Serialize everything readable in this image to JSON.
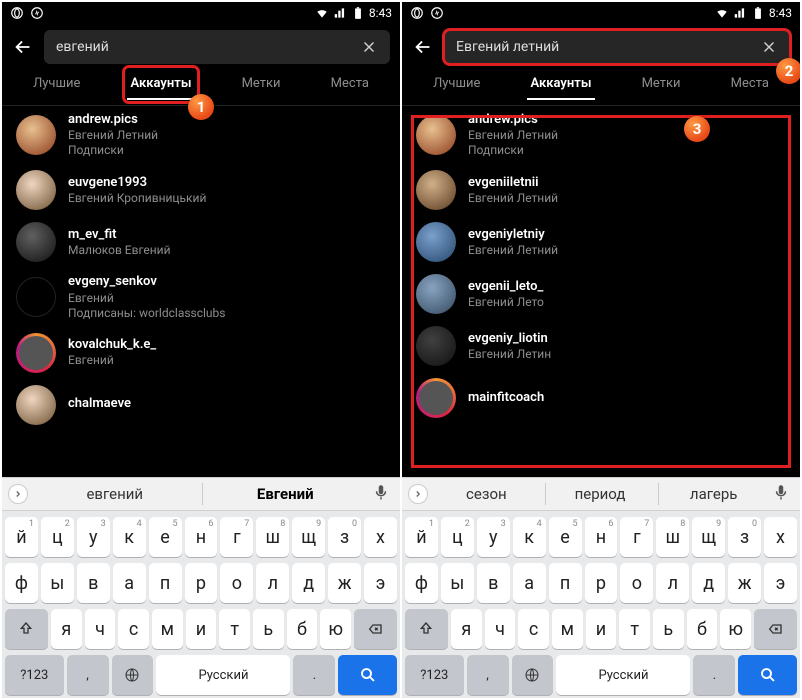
{
  "status": {
    "time": "8:43",
    "icons": [
      "opera-icon",
      "shazam-icon"
    ],
    "right_icons": [
      "wifi-icon",
      "signal-icon",
      "battery-icon"
    ]
  },
  "left": {
    "search": "евгений",
    "tabs": [
      "Лучшие",
      "Аккаунты",
      "Метки",
      "Места"
    ],
    "active_tab": 1,
    "results": [
      {
        "user": "andrew.pics",
        "full": "Евгений Летний",
        "sub": "Подписки",
        "av": "av-a"
      },
      {
        "user": "euvgene1993",
        "full": "Евгений Кропивницький",
        "av": "av-b"
      },
      {
        "user": "m_ev_fit",
        "full": "Малюков Евгений",
        "av": "av-c"
      },
      {
        "user": "evgeny_senkov",
        "full": "Евгений",
        "sub": "Подписаны: worldclassclubs",
        "av": "av-d"
      },
      {
        "user": "kovalchuk_k.e_",
        "full": "Евгений",
        "av": "ring"
      },
      {
        "user": "chalmaeve",
        "full": "",
        "av": "av-b"
      }
    ],
    "suggestions": [
      "евгений",
      "Евгений"
    ],
    "suggest_selected": 1
  },
  "right": {
    "search": "Евгений летний",
    "tabs": [
      "Лучшие",
      "Аккаунты",
      "Метки",
      "Места"
    ],
    "active_tab": 1,
    "results": [
      {
        "user": "andrew.pics",
        "full": "Евгений Летний",
        "sub": "Подписки",
        "av": "av-a"
      },
      {
        "user": "evgeniiletnii",
        "full": "Евгений Летний",
        "av": "av-f"
      },
      {
        "user": "evgeniyletniy",
        "full": "Евгений Летний",
        "av": "av-e"
      },
      {
        "user": "evgenii_leto_",
        "full": "Евгений Лето",
        "av": "av-g"
      },
      {
        "user": "evgeniy_liotin",
        "full": "Евгений Летин",
        "av": "av-h"
      },
      {
        "user": "mainfitcoach",
        "full": "",
        "av": "ring"
      }
    ],
    "suggestions": [
      "сезон",
      "период",
      "лагерь"
    ],
    "suggest_selected": -1
  },
  "keyboard": {
    "row1": [
      {
        "k": "й",
        "h": "1"
      },
      {
        "k": "ц",
        "h": "2"
      },
      {
        "k": "у",
        "h": "3"
      },
      {
        "k": "к",
        "h": "4"
      },
      {
        "k": "е",
        "h": "5"
      },
      {
        "k": "н",
        "h": "6"
      },
      {
        "k": "г",
        "h": "7"
      },
      {
        "k": "ш",
        "h": "8"
      },
      {
        "k": "щ",
        "h": "9"
      },
      {
        "k": "з",
        "h": "0"
      },
      {
        "k": "х",
        "h": ""
      }
    ],
    "row2": [
      {
        "k": "ф"
      },
      {
        "k": "ы"
      },
      {
        "k": "в"
      },
      {
        "k": "а"
      },
      {
        "k": "п"
      },
      {
        "k": "р"
      },
      {
        "k": "о"
      },
      {
        "k": "л"
      },
      {
        "k": "д"
      },
      {
        "k": "ж"
      },
      {
        "k": "э"
      }
    ],
    "row3": [
      {
        "k": "я"
      },
      {
        "k": "ч"
      },
      {
        "k": "с"
      },
      {
        "k": "м"
      },
      {
        "k": "и"
      },
      {
        "k": "т"
      },
      {
        "k": "ь"
      },
      {
        "k": "б"
      },
      {
        "k": "ю"
      }
    ],
    "bottom": {
      "mode": "?123",
      "comma": ",",
      "space": "Русский",
      "dot": "."
    }
  },
  "badges": {
    "b1": "1",
    "b2": "2",
    "b3": "3"
  }
}
